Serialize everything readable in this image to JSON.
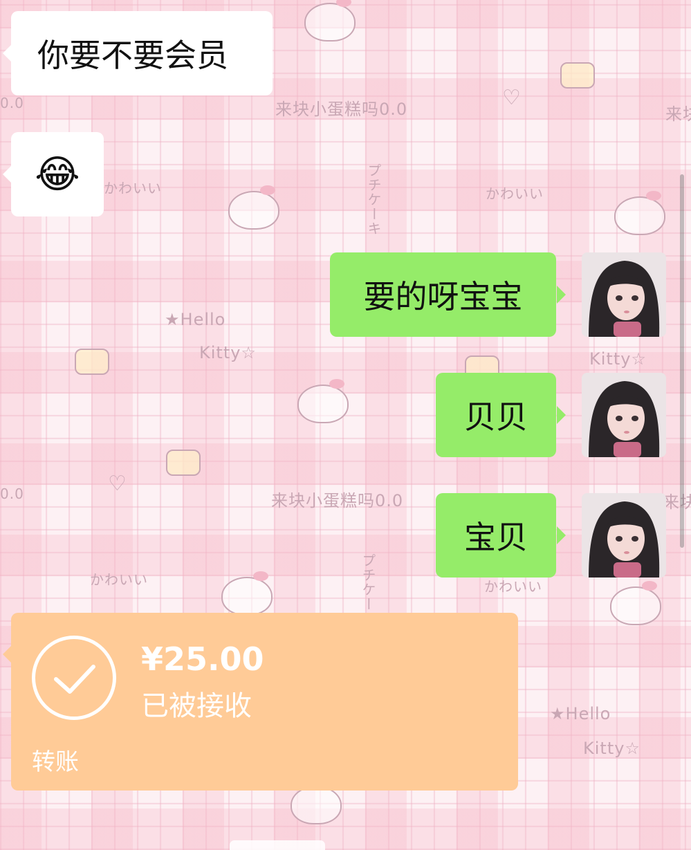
{
  "wallpaper": {
    "texts": [
      "来块小蛋糕吗0.0",
      "来块小蛋糕吗0.0",
      "かわいい",
      "かわいい",
      "かわいい",
      "かわいい",
      "★Hello",
      "Kitty☆",
      "Kitty☆",
      "★Hello",
      "Kitty☆",
      "プチケーキ",
      "プチケー",
      "来块",
      "来块",
      "0.0",
      "0.0"
    ],
    "colors": {
      "check": "#f6b6c6",
      "ink": "#c9a7b4"
    }
  },
  "messages": [
    {
      "side": "left",
      "type": "text",
      "text": "你要不要会员"
    },
    {
      "side": "left",
      "type": "emoji",
      "emoji": "😂"
    },
    {
      "side": "right",
      "type": "text",
      "text": "要的呀宝宝"
    },
    {
      "side": "right",
      "type": "text",
      "text": "贝贝"
    },
    {
      "side": "right",
      "type": "text",
      "text": "宝贝"
    }
  ],
  "transfer": {
    "amount": "¥25.00",
    "status": "已被接收",
    "label": "转账",
    "icon": "check-circle-icon",
    "color": "#ffcb97"
  },
  "colors": {
    "outgoing_bubble": "#95ec69",
    "incoming_bubble": "#ffffff",
    "transfer_accepted": "#ffcb97"
  }
}
